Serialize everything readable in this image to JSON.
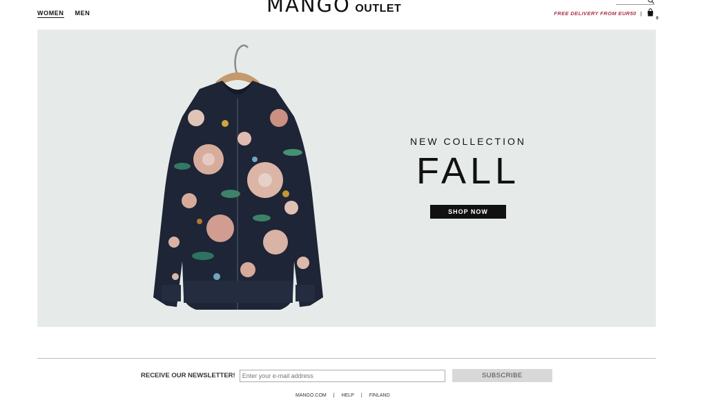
{
  "nav": {
    "women": "WOMEN",
    "men": "MEN"
  },
  "logo": {
    "brand": "MANGO",
    "sub": "OUTLET"
  },
  "header": {
    "delivery": "FREE DELIVERY FROM EUR50",
    "separator": "|",
    "cart_count": "0"
  },
  "banner": {
    "subtitle": "NEW COLLECTION",
    "title": "FALL",
    "cta": "SHOP NOW"
  },
  "newsletter": {
    "label": "RECEIVE OUR NEWSLETTER!",
    "placeholder": "Enter your e-mail address",
    "button": "SUBSCRIBE"
  },
  "footer": {
    "links": [
      "MANGO.COM",
      "HELP",
      "FINLAND"
    ],
    "separator": "|"
  },
  "colors": {
    "accent": "#b03048",
    "banner_bg": "#e6ebe9",
    "button_dark": "#111111",
    "subscribe_bg": "#d8d8d8"
  }
}
